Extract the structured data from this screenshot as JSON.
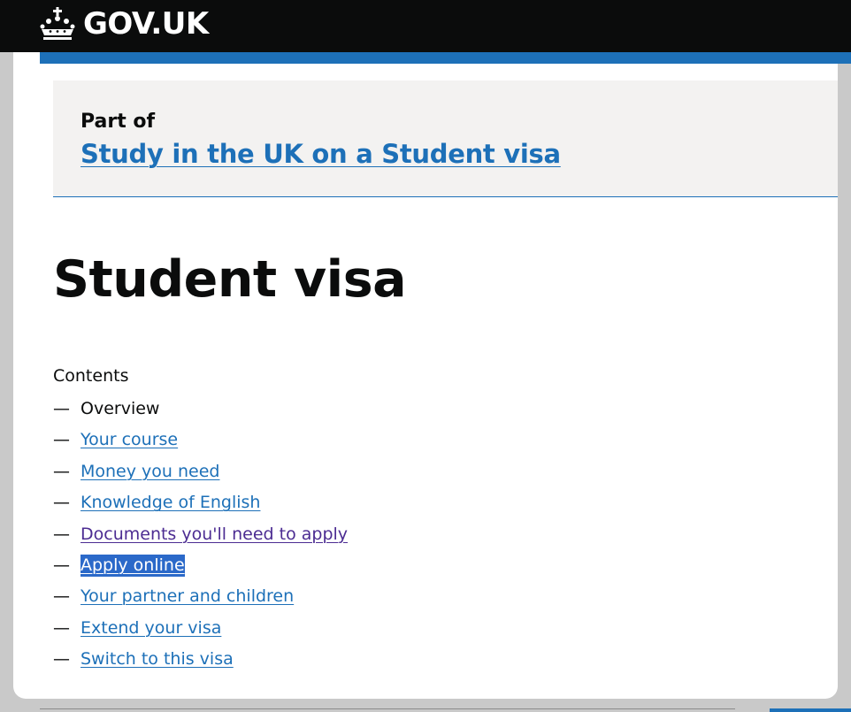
{
  "header": {
    "logo_icon": "crown-icon",
    "brand": "GOV.UK"
  },
  "breadcrumb": {
    "label": "Part of",
    "link": "Study in the UK on a Student visa"
  },
  "page": {
    "title": "Student visa"
  },
  "contents": {
    "label": "Contents",
    "dash": "—",
    "items": [
      {
        "label": "Overview",
        "state": "current"
      },
      {
        "label": "Your course",
        "state": "link"
      },
      {
        "label": "Money you need",
        "state": "link"
      },
      {
        "label": "Knowledge of English",
        "state": "link"
      },
      {
        "label": "Documents you'll need to apply",
        "state": "visited"
      },
      {
        "label": "Apply online",
        "state": "selected"
      },
      {
        "label": "Your partner and children",
        "state": "link"
      },
      {
        "label": "Extend your visa",
        "state": "link"
      },
      {
        "label": "Switch to this visa",
        "state": "link"
      }
    ]
  },
  "colors": {
    "header_bg": "#0b0c0c",
    "link": "#1d70b8",
    "visited_link": "#4c2c92",
    "selection": "#2b69c9",
    "panel_bg": "#f3f2f1"
  }
}
